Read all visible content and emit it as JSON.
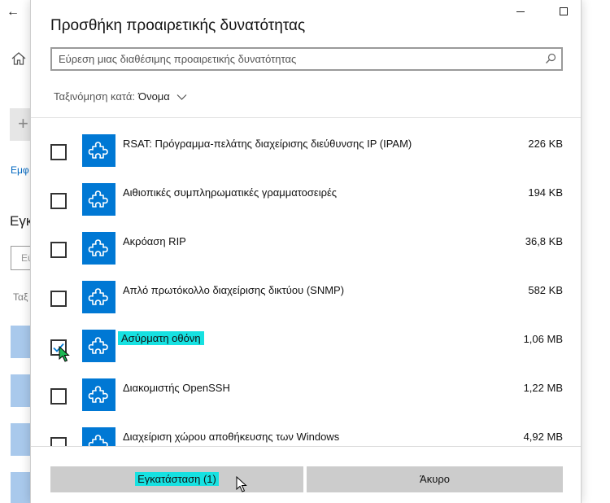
{
  "background": {
    "back_glyph": "←",
    "add_glyph": "+",
    "link_text": "Εμφ",
    "heading_text": "Εγκ",
    "input_text": "Εύ",
    "sort_text": "Ταξ"
  },
  "dialog": {
    "title": "Προσθήκη προαιρετικής δυνατότητας",
    "minimize_glyph": "—",
    "maximize_glyph": "☐",
    "search": {
      "placeholder": "Εύρεση μιας διαθέσιμης προαιρετικής δυνατότητας",
      "value": ""
    },
    "sort": {
      "label": "Ταξινόμηση κατά:",
      "value": "Όνομα"
    },
    "features": [
      {
        "name": "RSAT: Πρόγραμμα-πελάτης διαχείρισης διεύθυνσης IP (IPAM)",
        "size": "226 KB",
        "checked": false,
        "highlighted": false
      },
      {
        "name": "Αιθιοπικές συμπληρωματικές γραμματοσειρές",
        "size": "194 KB",
        "checked": false,
        "highlighted": false
      },
      {
        "name": "Ακρόαση RIP",
        "size": "36,8 KB",
        "checked": false,
        "highlighted": false
      },
      {
        "name": "Απλό πρωτόκολλο διαχείρισης δικτύου (SNMP)",
        "size": "582 KB",
        "checked": false,
        "highlighted": false
      },
      {
        "name": "Ασύρματη οθόνη",
        "size": "1,06 MB",
        "checked": true,
        "highlighted": true
      },
      {
        "name": "Διακομιστής OpenSSH",
        "size": "1,22 MB",
        "checked": false,
        "highlighted": false
      },
      {
        "name": "Διαχείριση χώρου αποθήκευσης των Windows",
        "size": "4,92 MB",
        "checked": false,
        "highlighted": false
      }
    ],
    "install_label": "Εγκατάσταση (1)",
    "cancel_label": "Άκυρο"
  },
  "colors": {
    "accent": "#0078d4",
    "highlight": "#17e1e1",
    "button_bg": "#cccccc"
  }
}
